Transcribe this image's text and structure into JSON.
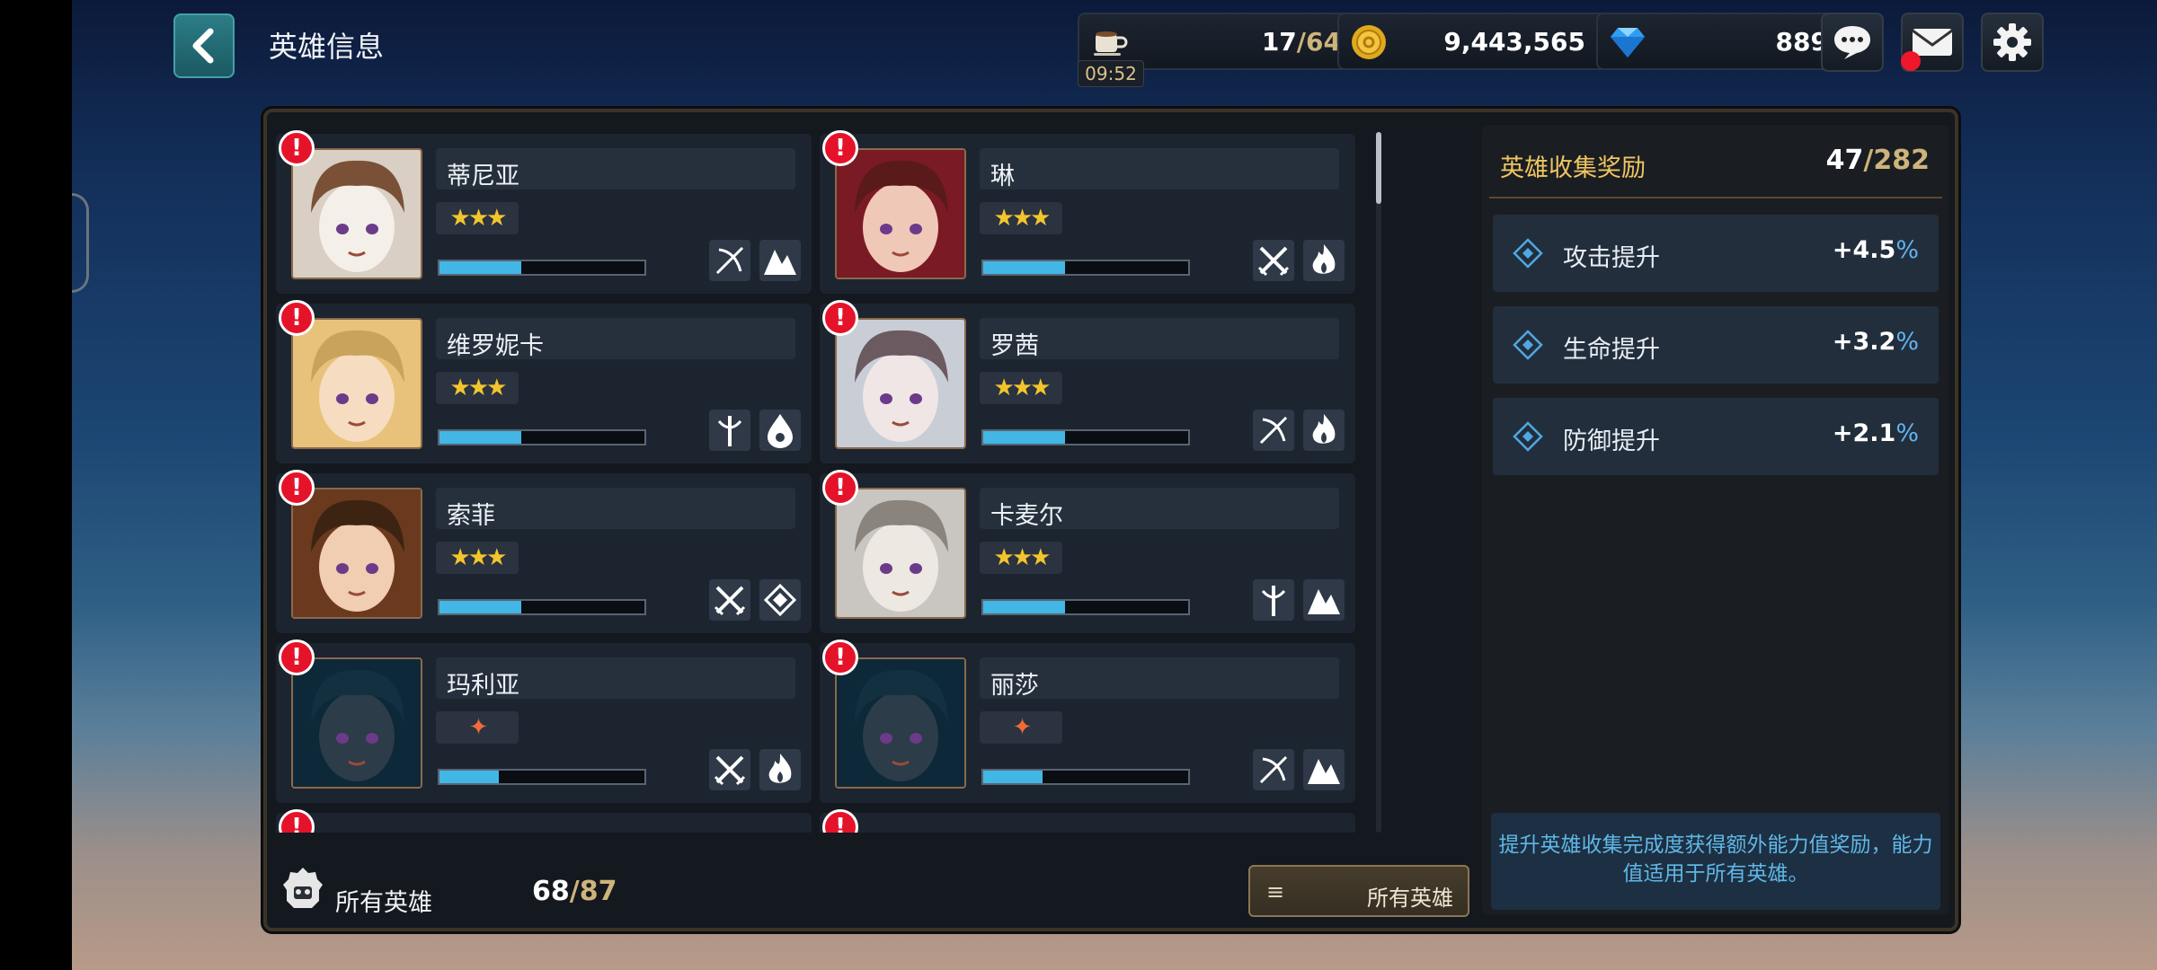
{
  "header": {
    "title": "英雄信息",
    "stamina": {
      "current": "17",
      "max": "/64",
      "timer": "09:52",
      "plus": "+"
    },
    "gold": {
      "value": "9,443,565",
      "plus": "+"
    },
    "gems": {
      "value": "889",
      "plus": "+"
    }
  },
  "heroes": [
    {
      "name": "蒂尼亚",
      "stars": "★★★",
      "progress": 0.4,
      "icons": [
        "bow-icon",
        "mountain-icon"
      ]
    },
    {
      "name": "琳",
      "stars": "★★★",
      "progress": 0.4,
      "icons": [
        "swords-icon",
        "fire-icon"
      ]
    },
    {
      "name": "维罗妮卡",
      "stars": "★★★",
      "progress": 0.4,
      "icons": [
        "staff-icon",
        "water-icon"
      ]
    },
    {
      "name": "罗茜",
      "stars": "★★★",
      "progress": 0.4,
      "icons": [
        "bow-icon",
        "fire-icon"
      ]
    },
    {
      "name": "索菲",
      "stars": "★★★",
      "progress": 0.4,
      "icons": [
        "swords-icon",
        "wind-icon"
      ]
    },
    {
      "name": "卡麦尔",
      "stars": "★★★",
      "progress": 0.4,
      "icons": [
        "staff-icon",
        "mountain-icon"
      ]
    },
    {
      "name": "玛利亚",
      "stars": "✦",
      "progress": 0.29,
      "icons": [
        "swords-icon",
        "fire-icon"
      ]
    },
    {
      "name": "丽莎",
      "stars": "✦",
      "progress": 0.29,
      "icons": [
        "bow-icon",
        "mountain-icon"
      ]
    }
  ],
  "footer": {
    "all_heroes_label": "所有英雄",
    "count": "68",
    "max": "/87",
    "filter_label": "所有英雄"
  },
  "reward": {
    "title": "英雄收集奖励",
    "count": "47",
    "max": "/282",
    "bonuses": [
      {
        "label": "攻击提升",
        "value": "+4.5",
        "unit": "%"
      },
      {
        "label": "生命提升",
        "value": "+3.2",
        "unit": "%"
      },
      {
        "label": "防御提升",
        "value": "+2.1",
        "unit": "%"
      }
    ],
    "hint": "提升英雄收集完成度获得额外能力值奖励，能力值适用于所有英雄。"
  },
  "colors": {
    "accent_blue": "#42b7e6",
    "gold_text": "#f0c660",
    "alert_red": "#e5132a"
  }
}
